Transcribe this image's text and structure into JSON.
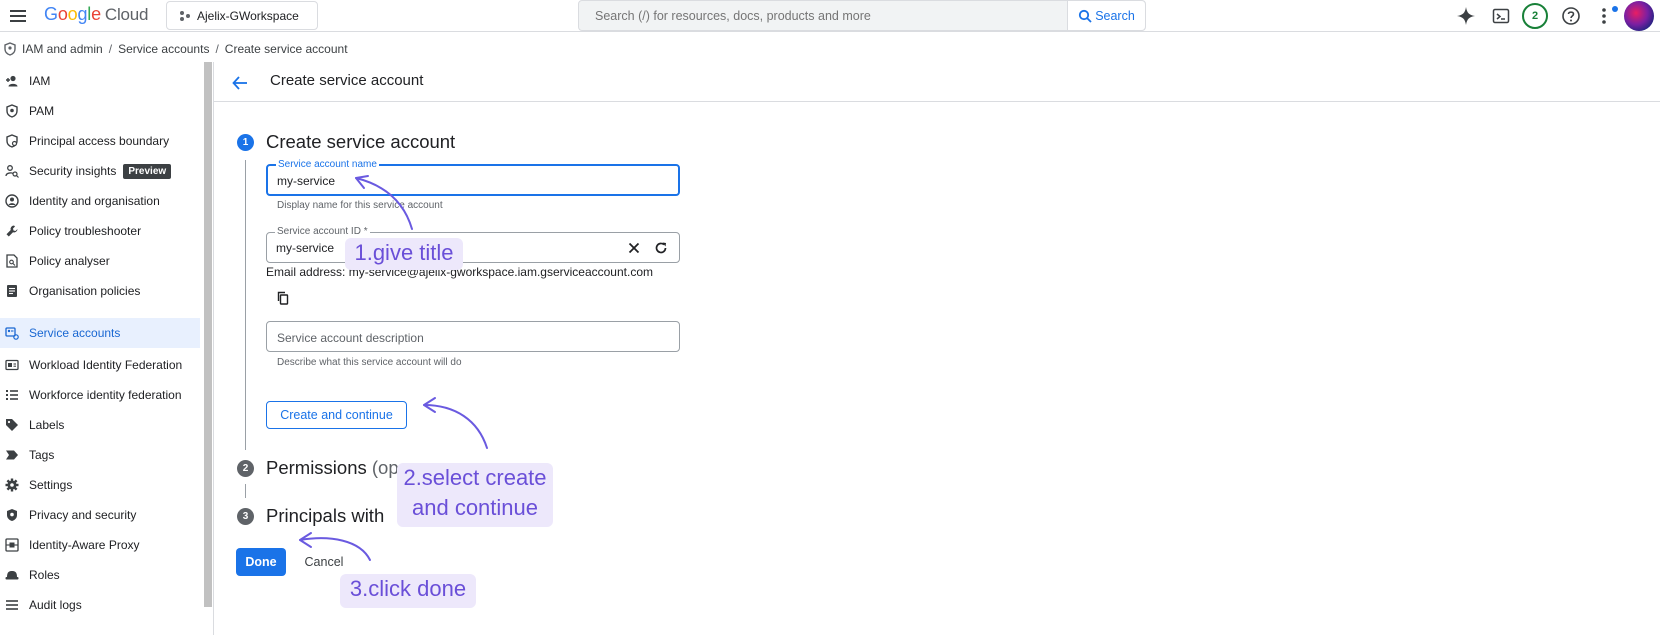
{
  "topbar": {
    "logo_google": [
      "G",
      "o",
      "o",
      "g",
      "l",
      "e"
    ],
    "logo_cloud": "Cloud",
    "project": "Ajelix-GWorkspace",
    "search_placeholder": "Search (/) for resources, docs, products and more",
    "search_button": "Search",
    "notification_count": "2",
    "icons": [
      "menu-icon",
      "gemini-sparkle-icon",
      "cloud-shell-terminal-icon",
      "help-icon",
      "more-vert-icon"
    ]
  },
  "breadcrumb": {
    "items": [
      "IAM and admin",
      "Service accounts",
      "Create service account"
    ],
    "separator": "/"
  },
  "sidebar": {
    "items": [
      {
        "label": "IAM",
        "icon": "person-add-icon"
      },
      {
        "label": "PAM",
        "icon": "shield-icon"
      },
      {
        "label": "Principal access boundary",
        "icon": "boundary-icon"
      },
      {
        "label": "Security insights",
        "icon": "person-search-icon",
        "badge": "Preview"
      },
      {
        "label": "Identity and organisation",
        "icon": "account-circle-icon"
      },
      {
        "label": "Policy troubleshooter",
        "icon": "wrench-icon"
      },
      {
        "label": "Policy analyser",
        "icon": "document-search-icon"
      },
      {
        "label": "Organisation policies",
        "icon": "list-doc-icon"
      },
      {
        "label": "Service accounts",
        "icon": "service-account-icon",
        "active": true
      },
      {
        "label": "Workload Identity Federation",
        "icon": "id-card-icon"
      },
      {
        "label": "Workforce identity federation",
        "icon": "list-icon"
      },
      {
        "label": "Labels",
        "icon": "label-icon"
      },
      {
        "label": "Tags",
        "icon": "tag-icon"
      },
      {
        "label": "Settings",
        "icon": "gear-icon"
      },
      {
        "label": "Privacy and security",
        "icon": "privacy-shield-icon"
      },
      {
        "label": "Identity-Aware Proxy",
        "icon": "proxy-icon"
      },
      {
        "label": "Roles",
        "icon": "roles-hat-icon"
      },
      {
        "label": "Audit logs",
        "icon": "audit-list-icon"
      }
    ]
  },
  "page": {
    "title": "Create service account"
  },
  "steps": [
    {
      "number": "1",
      "title": "Create service account",
      "active": true
    },
    {
      "number": "2",
      "title": "Permissions",
      "suffix": "(op"
    },
    {
      "number": "3",
      "title": "Principals with"
    }
  ],
  "form": {
    "name_label": "Service account name",
    "name_value": "my-service",
    "name_helper": "Display name for this service account",
    "id_label": "Service account ID *",
    "id_value": "my-service",
    "email_prefix": "Email address:",
    "email_value": "my-service@ajelix-gworkspace.iam.gserviceaccount.com",
    "description_placeholder": "Service account description",
    "description_helper": "Describe what this service account will do",
    "create_button": "Create and continue",
    "done_button": "Done",
    "cancel_button": "Cancel"
  },
  "annotations": {
    "note1": "1.give title",
    "note2_line1": "2.select create",
    "note2_line2": "and continue",
    "note3": "3.click done"
  },
  "colors": {
    "accent": "#1a73e8",
    "annotation_text": "#6a4fd8",
    "annotation_bg": "#ede8fb",
    "active_nav_bg": "#e8f0fe"
  }
}
